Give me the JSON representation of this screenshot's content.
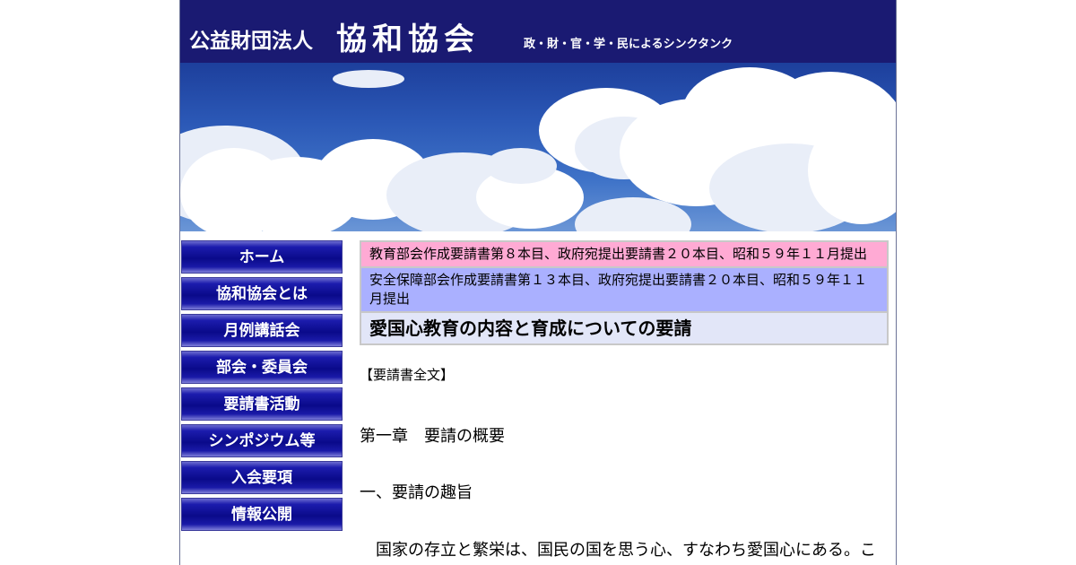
{
  "header": {
    "org_prefix": "公益財団法人",
    "org_name": "協和協会",
    "tagline": "政・財・官・学・民によるシンクタンク"
  },
  "nav": {
    "items": [
      {
        "label": "ホーム"
      },
      {
        "label": "協和協会とは"
      },
      {
        "label": "月例講話会"
      },
      {
        "label": "部会・委員会"
      },
      {
        "label": "要請書活動"
      },
      {
        "label": "シンポジウム等"
      },
      {
        "label": "入会要項"
      },
      {
        "label": "情報公開"
      }
    ]
  },
  "main": {
    "info_pink": "教育部会作成要請書第８本目、政府宛提出要請書２０本目、昭和５９年１１月提出",
    "info_blue": "安全保障部会作成要請書第１３本目、政府宛提出要請書２０本目、昭和５９年１１月提出",
    "title": "愛国心教育の内容と育成についての要請",
    "doc_label": "【要請書全文】",
    "chapter": "第一章　要請の概要",
    "section": "一、要請の趣旨",
    "paragraph": "国家の存立と繁栄は、国民の国を思う心、すなわち愛国心にある。こ"
  },
  "colors": {
    "header_bg": "#1a1a72",
    "nav_bg": "#0a0a8a",
    "info_pink_bg": "#ffaad4",
    "info_blue_bg": "#aab0ff",
    "title_bg": "#e2e6f8"
  }
}
